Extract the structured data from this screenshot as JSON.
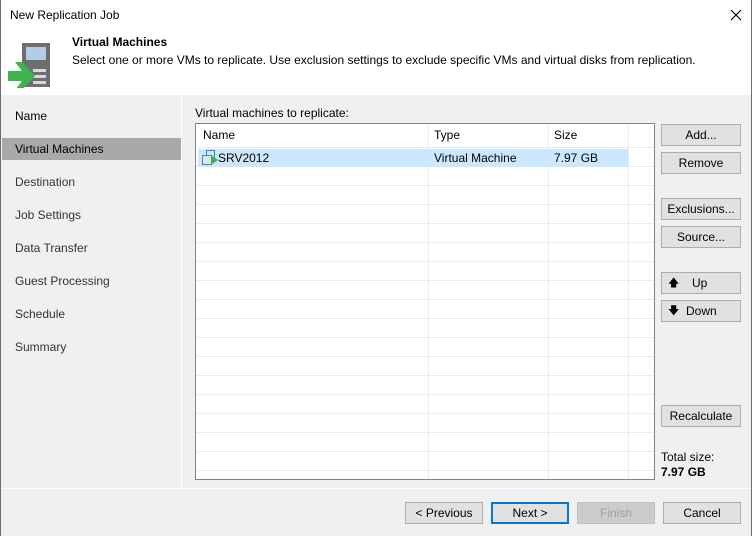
{
  "window": {
    "title": "New Replication Job",
    "close_icon": "close-icon"
  },
  "header": {
    "title": "Virtual Machines",
    "description": "Select one or more VMs to replicate. Use exclusion settings to exclude specific VMs and virtual disks from replication.",
    "icon": "replication-job-icon"
  },
  "sidebar": {
    "items": [
      {
        "label": "Name",
        "state": "done"
      },
      {
        "label": "Virtual Machines",
        "state": "active"
      },
      {
        "label": "Destination",
        "state": "pending"
      },
      {
        "label": "Job Settings",
        "state": "pending"
      },
      {
        "label": "Data Transfer",
        "state": "pending"
      },
      {
        "label": "Guest Processing",
        "state": "pending"
      },
      {
        "label": "Schedule",
        "state": "pending"
      },
      {
        "label": "Summary",
        "state": "pending"
      }
    ]
  },
  "main": {
    "list_label": "Virtual machines to replicate:",
    "table": {
      "columns": [
        "Name",
        "Type",
        "Size"
      ],
      "rows": [
        {
          "name": "SRV2012",
          "type": "Virtual Machine",
          "size": "7.97 GB",
          "icon": "vm-icon",
          "selected": true
        }
      ]
    },
    "buttons": {
      "add": "Add...",
      "remove": "Remove",
      "exclusions": "Exclusions...",
      "source": "Source...",
      "up": "Up",
      "down": "Down",
      "recalculate": "Recalculate"
    },
    "total_size_label": "Total size:",
    "total_size_value": "7.97 GB"
  },
  "footer": {
    "previous": "< Previous",
    "next": "Next >",
    "finish": "Finish",
    "cancel": "Cancel"
  },
  "colors": {
    "selection": "#cce8ff",
    "active_nav": "#a9a9a9",
    "default_button_border": "#0078d7",
    "arrow_green": "#3cb44b"
  }
}
